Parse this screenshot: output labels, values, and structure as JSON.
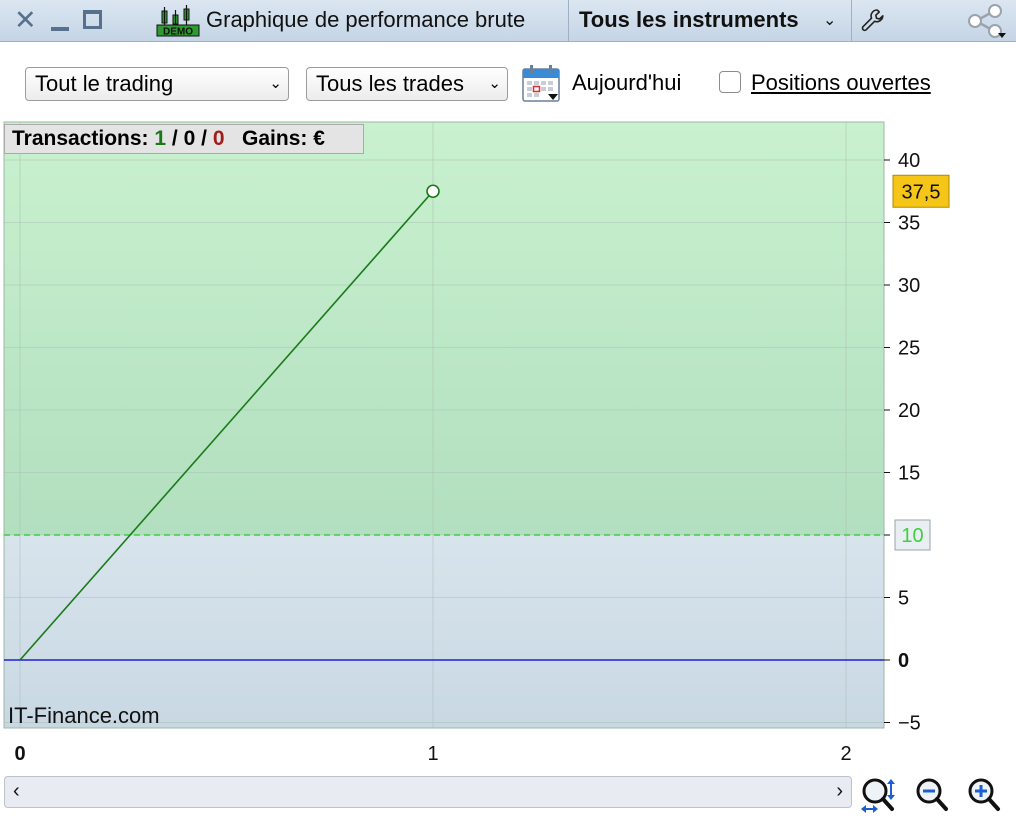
{
  "window": {
    "title": "Graphique de performance brute",
    "demo_badge": "DEMO",
    "instrument_selector": "Tous les instruments"
  },
  "toolbar": {
    "trading_filter": "Tout le trading",
    "trades_filter": "Tous les trades",
    "date_label": "Aujourd'hui",
    "open_positions_checked": false,
    "open_positions_label": "Positions ouvertes"
  },
  "stats": {
    "transactions_label": "Transactions:",
    "wins": "1",
    "sep1": "/",
    "neutral": "0",
    "sep2": "/",
    "losses": "0",
    "gains_label": "Gains: €"
  },
  "watermark": "IT-Finance.com",
  "colors": {
    "profit_zone": "#c6efcc",
    "loss_zone": "#d4e0e8",
    "equity_line": "#1a7a1a",
    "zero_line": "#2020cc",
    "target_line": "#3fcf3f",
    "last_value_badge": "#f5c518"
  },
  "icons": {
    "close": "close-icon",
    "minimize": "minimize-icon",
    "maximize": "maximize-icon",
    "settings": "wrench-icon",
    "share": "share-icon",
    "calendar": "calendar-icon",
    "zoom_auto": "zoom-auto-icon",
    "zoom_out": "zoom-out-icon",
    "zoom_in": "zoom-in-icon"
  },
  "chart_data": {
    "type": "line",
    "series": [
      {
        "x": [
          0,
          1
        ],
        "y": [
          0,
          37.5
        ]
      }
    ],
    "xticks": [
      "0",
      "1",
      "2"
    ],
    "yticks": [
      "40",
      "35",
      "30",
      "25",
      "20",
      "15",
      "10",
      "5",
      "0",
      "−5"
    ],
    "xlim": [
      0,
      2.1
    ],
    "ylim": [
      -5.5,
      43
    ],
    "zero_line": 0,
    "target_value": 10,
    "target_label": "10",
    "last_value": 37.5,
    "last_value_label": "37,5",
    "grid": true
  }
}
